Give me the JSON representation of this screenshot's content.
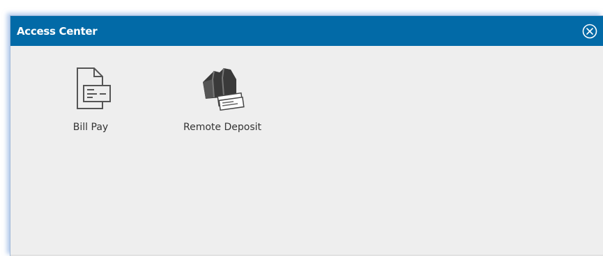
{
  "window": {
    "title": "Access Center",
    "close_icon": "close-circle-icon",
    "titlebar_color": "#026aa7",
    "background_color": "#eeeeee"
  },
  "tiles": [
    {
      "label": "Bill Pay",
      "icon": "bill-document-icon"
    },
    {
      "label": "Remote Deposit",
      "icon": "check-scanner-icon"
    }
  ]
}
